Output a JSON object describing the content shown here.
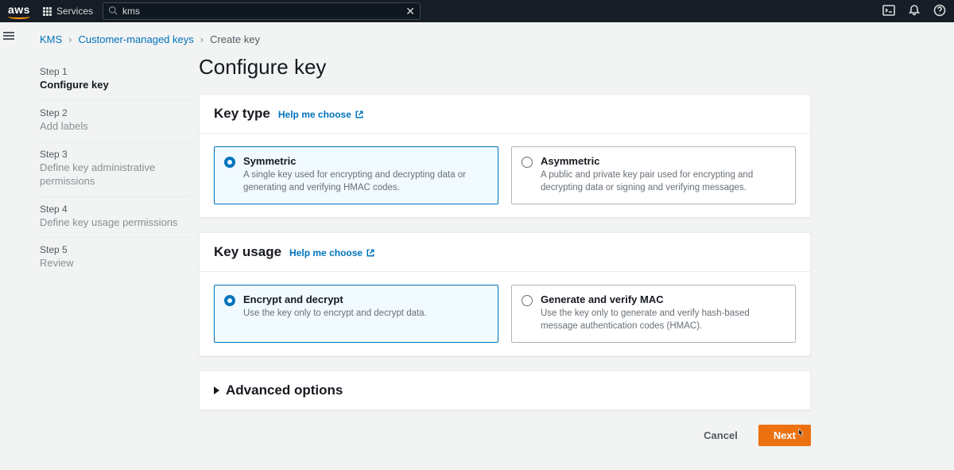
{
  "nav": {
    "services_label": "Services",
    "search_value": "kms"
  },
  "breadcrumb": {
    "root": "KMS",
    "mid": "Customer-managed keys",
    "current": "Create key"
  },
  "steps": [
    {
      "num": "Step 1",
      "label": "Configure key",
      "active": true
    },
    {
      "num": "Step 2",
      "label": "Add labels",
      "active": false
    },
    {
      "num": "Step 3",
      "label": "Define key administrative permissions",
      "active": false
    },
    {
      "num": "Step 4",
      "label": "Define key usage permissions",
      "active": false
    },
    {
      "num": "Step 5",
      "label": "Review",
      "active": false
    }
  ],
  "page": {
    "title": "Configure key"
  },
  "key_type": {
    "title": "Key type",
    "help": "Help me choose",
    "options": [
      {
        "title": "Symmetric",
        "desc": "A single key used for encrypting and decrypting data or generating and verifying HMAC codes.",
        "selected": true
      },
      {
        "title": "Asymmetric",
        "desc": "A public and private key pair used for encrypting and decrypting data or signing and verifying messages.",
        "selected": false
      }
    ]
  },
  "key_usage": {
    "title": "Key usage",
    "help": "Help me choose",
    "options": [
      {
        "title": "Encrypt and decrypt",
        "desc": "Use the key only to encrypt and decrypt data.",
        "selected": true
      },
      {
        "title": "Generate and verify MAC",
        "desc": "Use the key only to generate and verify hash-based message authentication codes (HMAC).",
        "selected": false
      }
    ]
  },
  "advanced": {
    "title": "Advanced options"
  },
  "actions": {
    "cancel": "Cancel",
    "next": "Next"
  }
}
